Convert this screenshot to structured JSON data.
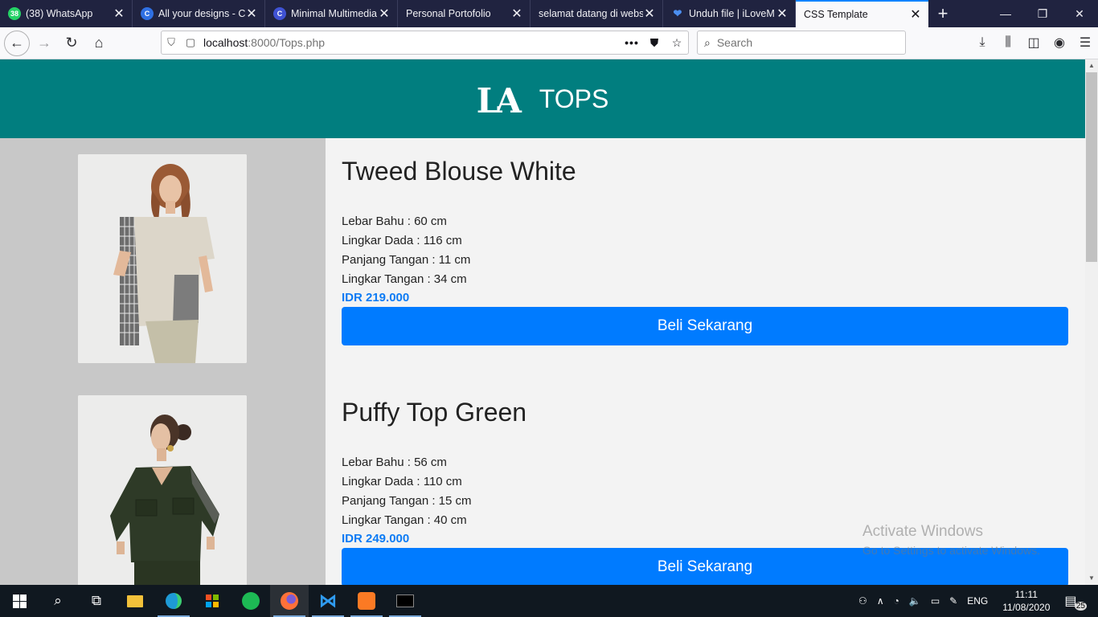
{
  "browser": {
    "tabs": [
      {
        "title": "(38) WhatsApp",
        "icon": "whatsapp-icon",
        "color": "#25d366",
        "glyph": "38"
      },
      {
        "title": "All your designs - C",
        "icon": "canva-icon",
        "color": "#2f70e3",
        "glyph": "C"
      },
      {
        "title": "Minimal Multimedia",
        "icon": "canva-icon",
        "color": "#3f52d4",
        "glyph": "C"
      },
      {
        "title": "Personal Portofolio",
        "icon": "",
        "color": "",
        "glyph": ""
      },
      {
        "title": "selamat datang di website",
        "icon": "",
        "color": "",
        "glyph": ""
      },
      {
        "title": "Unduh file | iLoveM",
        "icon": "heart-icon",
        "color": "#4b8ef0",
        "glyph": "❤"
      },
      {
        "title": "CSS Template",
        "icon": "",
        "color": "",
        "glyph": ""
      }
    ],
    "url_host": "localhost",
    "url_path": ":8000/Tops.php",
    "search_placeholder": "Search"
  },
  "site": {
    "logo": "LA",
    "title": "TOPS"
  },
  "products": [
    {
      "name": "Tweed Blouse White",
      "lebar_bahu": "Lebar Bahu : 60 cm",
      "lingkar_dada": "Lingkar Dada : 116 cm",
      "panjang_tangan": "Panjang Tangan : 11 cm",
      "lingkar_tangan": "Lingkar Tangan : 34 cm",
      "price": "IDR 219.000",
      "button": "Beli Sekarang"
    },
    {
      "name": "Puffy Top Green",
      "lebar_bahu": "Lebar Bahu : 56 cm",
      "lingkar_dada": "Lingkar Dada : 110 cm",
      "panjang_tangan": "Panjang Tangan : 15 cm",
      "lingkar_tangan": "Lingkar Tangan : 40 cm",
      "price": "IDR 249.000",
      "button": "Beli Sekarang"
    }
  ],
  "watermark": {
    "line1": "Activate Windows",
    "line2": "Go to Settings to activate Windows."
  },
  "taskbar": {
    "language": "ENG",
    "time": "11:11",
    "date": "11/08/2020",
    "notifications": "25"
  }
}
